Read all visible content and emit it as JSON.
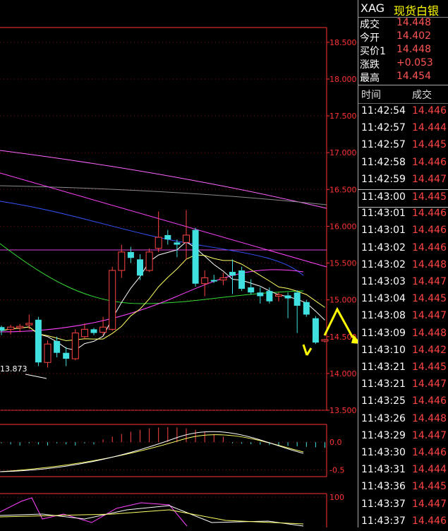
{
  "quote": {
    "symbol": "XAG",
    "name": "现货白银",
    "rows": [
      {
        "label": "成交",
        "value": "14.448"
      },
      {
        "label": "今开",
        "value": "14.402"
      },
      {
        "label": "买价1",
        "value": "14.448"
      },
      {
        "label": "涨跌",
        "value": "+0.053"
      },
      {
        "label": "最高",
        "value": "14.454"
      }
    ]
  },
  "trades": {
    "headers": {
      "time": "时间",
      "price": "成交"
    },
    "rows": [
      {
        "time": "11:42:54",
        "price": "14.446"
      },
      {
        "time": "11:42:57",
        "price": "14.444"
      },
      {
        "time": "11:42:57",
        "price": "14.445"
      },
      {
        "time": "11:42:58",
        "price": "14.446"
      },
      {
        "time": "11:42:59",
        "price": "14.447"
      },
      {
        "time": "11:43:00",
        "price": "14.445"
      },
      {
        "time": "11:43:01",
        "price": "14.446"
      },
      {
        "time": "11:43:01",
        "price": "14.446"
      },
      {
        "time": "11:43:02",
        "price": "14.446"
      },
      {
        "time": "11:43:02",
        "price": "14.448"
      },
      {
        "time": "11:43:03",
        "price": "14.447"
      },
      {
        "time": "11:43:04",
        "price": "14.445"
      },
      {
        "time": "11:43:08",
        "price": "14.447"
      },
      {
        "time": "11:43:09",
        "price": "14.448"
      },
      {
        "time": "11:43:10",
        "price": "14.442"
      },
      {
        "time": "11:43:21",
        "price": "14.445"
      },
      {
        "time": "11:43:21",
        "price": "14.447"
      },
      {
        "time": "11:43:25",
        "price": "14.446"
      },
      {
        "time": "11:43:26",
        "price": "14.448"
      },
      {
        "time": "11:43:29",
        "price": "14.447"
      },
      {
        "time": "11:43:30",
        "price": "14.446"
      },
      {
        "time": "11:43:31",
        "price": "14.444"
      },
      {
        "time": "11:43:36",
        "price": "14.445"
      },
      {
        "time": "11:43:37",
        "price": "14.447"
      },
      {
        "time": "11:43:37",
        "price": "14.446"
      }
    ]
  },
  "colors": {
    "up": "#ff4444",
    "down": "#40e0e0",
    "axis": "#ff3333",
    "ma_white": "#ffffff",
    "ma_yellow": "#ffff66",
    "ma_magenta": "#ff44ff",
    "ma_green": "#33dd33",
    "ma_blue": "#3355ff",
    "arrow": "#ffff00",
    "hline": "#dd44dd"
  },
  "chart_data": [
    {
      "type": "candlestick",
      "y_ticks": [
        "18.500",
        "18.000",
        "17.500",
        "17.000",
        "16.500",
        "16.000",
        "15.500",
        "15.000",
        "14.500",
        "14.000",
        "13.500"
      ],
      "ylim": [
        13.5,
        18.7
      ],
      "annotation": "13.873",
      "candles": [
        {
          "o": 14.63,
          "h": 14.65,
          "l": 14.52,
          "c": 14.58
        },
        {
          "o": 14.6,
          "h": 14.66,
          "l": 14.53,
          "c": 14.63
        },
        {
          "o": 14.62,
          "h": 14.67,
          "l": 14.56,
          "c": 14.64
        },
        {
          "o": 14.66,
          "h": 14.8,
          "l": 14.6,
          "c": 14.68
        },
        {
          "o": 14.73,
          "h": 14.77,
          "l": 14.1,
          "c": 14.15
        },
        {
          "o": 14.15,
          "h": 14.45,
          "l": 14.08,
          "c": 14.4
        },
        {
          "o": 14.44,
          "h": 14.5,
          "l": 14.22,
          "c": 14.28
        },
        {
          "o": 14.28,
          "h": 14.36,
          "l": 14.1,
          "c": 14.2
        },
        {
          "o": 14.2,
          "h": 14.6,
          "l": 14.18,
          "c": 14.55
        },
        {
          "o": 14.5,
          "h": 14.68,
          "l": 14.47,
          "c": 14.6
        },
        {
          "o": 14.6,
          "h": 14.62,
          "l": 14.52,
          "c": 14.55
        },
        {
          "o": 14.56,
          "h": 14.77,
          "l": 14.52,
          "c": 14.63
        },
        {
          "o": 14.6,
          "h": 15.45,
          "l": 14.58,
          "c": 15.4
        },
        {
          "o": 15.4,
          "h": 15.75,
          "l": 15.3,
          "c": 15.65
        },
        {
          "o": 15.65,
          "h": 15.72,
          "l": 15.5,
          "c": 15.57
        },
        {
          "o": 15.55,
          "h": 15.62,
          "l": 15.27,
          "c": 15.33
        },
        {
          "o": 15.4,
          "h": 15.7,
          "l": 15.38,
          "c": 15.65
        },
        {
          "o": 15.7,
          "h": 16.2,
          "l": 15.65,
          "c": 15.85
        },
        {
          "o": 15.88,
          "h": 15.95,
          "l": 15.75,
          "c": 15.82
        },
        {
          "o": 15.78,
          "h": 15.82,
          "l": 15.58,
          "c": 15.75
        },
        {
          "o": 15.78,
          "h": 16.22,
          "l": 15.55,
          "c": 15.88
        },
        {
          "o": 15.95,
          "h": 15.98,
          "l": 15.18,
          "c": 15.22
        },
        {
          "o": 15.22,
          "h": 15.4,
          "l": 15.05,
          "c": 15.3
        },
        {
          "o": 15.27,
          "h": 15.34,
          "l": 15.23,
          "c": 15.25
        },
        {
          "o": 15.27,
          "h": 15.37,
          "l": 15.2,
          "c": 15.3
        },
        {
          "o": 15.38,
          "h": 15.55,
          "l": 15.08,
          "c": 15.33
        },
        {
          "o": 15.4,
          "h": 15.45,
          "l": 15.12,
          "c": 15.15
        },
        {
          "o": 15.17,
          "h": 15.28,
          "l": 15.07,
          "c": 15.1
        },
        {
          "o": 15.1,
          "h": 15.17,
          "l": 14.95,
          "c": 15.05
        },
        {
          "o": 15.12,
          "h": 15.17,
          "l": 14.95,
          "c": 14.98
        },
        {
          "o": 15.05,
          "h": 15.1,
          "l": 14.98,
          "c": 15.07
        },
        {
          "o": 15.06,
          "h": 15.1,
          "l": 14.75,
          "c": 15.02
        },
        {
          "o": 15.1,
          "h": 15.13,
          "l": 14.55,
          "c": 14.92
        },
        {
          "o": 14.97,
          "h": 15.0,
          "l": 14.77,
          "c": 14.8
        },
        {
          "o": 14.75,
          "h": 14.78,
          "l": 14.4,
          "c": 14.42
        },
        {
          "o": 14.44,
          "h": 14.47,
          "l": 14.42,
          "c": 14.46
        }
      ]
    },
    {
      "type": "line",
      "panel": "macd",
      "y_ticks": [
        "0.0",
        "-0.5"
      ],
      "ylim": [
        -0.62,
        0.32
      ]
    },
    {
      "type": "line",
      "panel": "kdj",
      "y_ticks": [
        "100"
      ],
      "ylim": [
        0,
        110
      ]
    }
  ]
}
